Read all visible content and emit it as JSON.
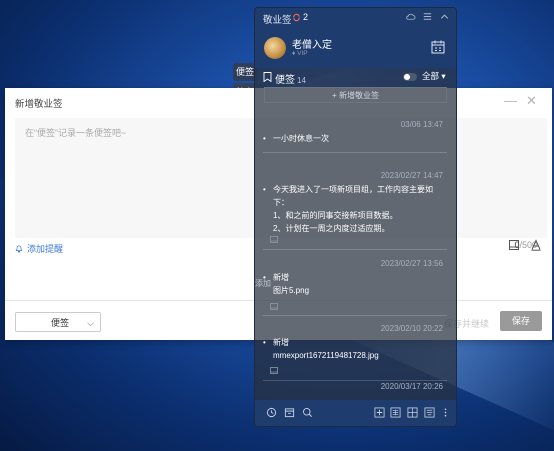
{
  "side_tabs": [
    "便签",
    "待办",
    "+"
  ],
  "editor": {
    "title": "新增敬业签",
    "placeholder": "在“便签”记录一条便签吧~",
    "count_current": "0",
    "count_max": "/500",
    "remind_label": "添加提醒",
    "category_value": "便签",
    "save_continue": "保存并继续",
    "save_label": "保存"
  },
  "panel": {
    "app_name": "敬业签",
    "sync_count": "2",
    "username": "老僧入定",
    "vip": "VIP",
    "list_label": "便签",
    "list_count": "14",
    "filter_label": "全部",
    "new_label": "+ 新增敬业签",
    "ghost_label": "添加",
    "notes": [
      {
        "date": "03/06 13:47",
        "lines": [
          "一小时休息一次"
        ],
        "attachment": false
      },
      {
        "date": "2023/02/27 14:47",
        "lines": [
          "今天我进入了一项新项目组，工作内容主要如",
          "下：",
          "1、和之前的同事交接新项目数据。",
          "2、计划在一周之内度过适应期。"
        ],
        "attachment": true
      },
      {
        "date": "2023/02/27 13:56",
        "lines": [
          "新增",
          "图片5.png"
        ],
        "attachment": true
      },
      {
        "date": "2023/02/10 20:22",
        "lines": [
          "新增",
          "mmexport1672119481728.jpg"
        ],
        "attachment": true
      },
      {
        "date": "2020/03/17 20:26",
        "lines": [
          ""
        ],
        "attachment": false
      }
    ]
  },
  "colors": {
    "panel_bar": "#1e3c6e",
    "link_blue": "#3d7bd8",
    "save_gray": "#9a9a9a"
  }
}
